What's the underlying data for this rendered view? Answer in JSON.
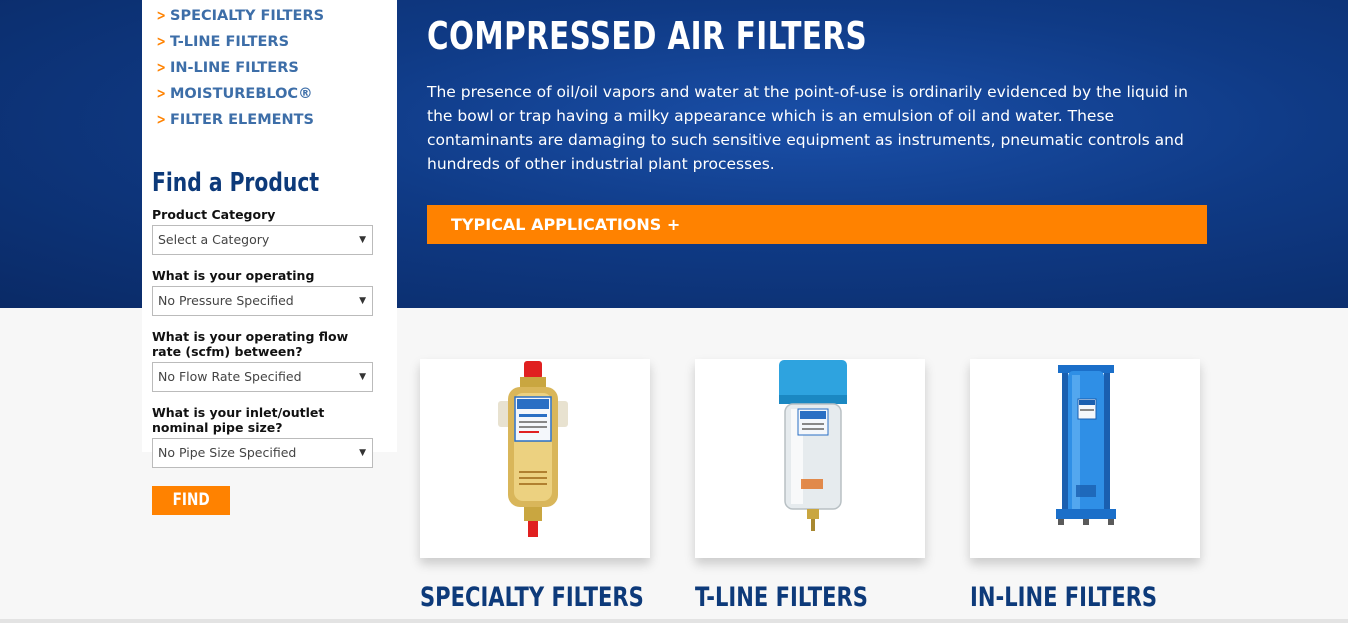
{
  "hero": {
    "title": "COMPRESSED AIR FILTERS",
    "text": "The presence of oil/oil vapors and water at the point-of-use is ordinarily evidenced by the liquid in the bowl or trap having a milky appearance which is an emulsion of oil and water. These contaminants are damaging to such sensitive equipment as instruments, pneumatic controls and hundreds of other industrial plant processes.",
    "applications_label": "TYPICAL APPLICATIONS +"
  },
  "sidebar": {
    "nav": [
      {
        "label": "SPECIALTY FILTERS",
        "icon": "chevron-right-icon"
      },
      {
        "label": "T-LINE FILTERS",
        "icon": "chevron-right-icon"
      },
      {
        "label": "IN-LINE FILTERS",
        "icon": "chevron-right-icon"
      },
      {
        "label": "MOISTUREBLOC®",
        "icon": "chevron-right-icon"
      },
      {
        "label": "FILTER ELEMENTS",
        "icon": "chevron-right-icon"
      }
    ],
    "find_title": "Find a Product",
    "fields": [
      {
        "label": "Product Category",
        "value": "Select a Category"
      },
      {
        "label": "What is your operating pressure?",
        "value": "No Pressure Specified"
      },
      {
        "label": "What is your operating flow rate (scfm) between?",
        "value": "No Flow Rate Specified"
      },
      {
        "label": "What is your inlet/outlet nominal pipe size?",
        "value": "No Pipe Size Specified"
      }
    ],
    "find_button": "FIND"
  },
  "products": [
    {
      "title": "SPECIALTY FILTERS",
      "image": "specialty-filter-image"
    },
    {
      "title": "T-LINE FILTERS",
      "image": "t-line-filter-image"
    },
    {
      "title": "IN-LINE FILTERS",
      "image": "in-line-filter-image"
    }
  ],
  "colors": {
    "hero_blue": "#0f3a85",
    "accent_orange": "#ff8200",
    "nav_blue": "#3d6ea8",
    "title_navy": "#0d3a7a"
  }
}
